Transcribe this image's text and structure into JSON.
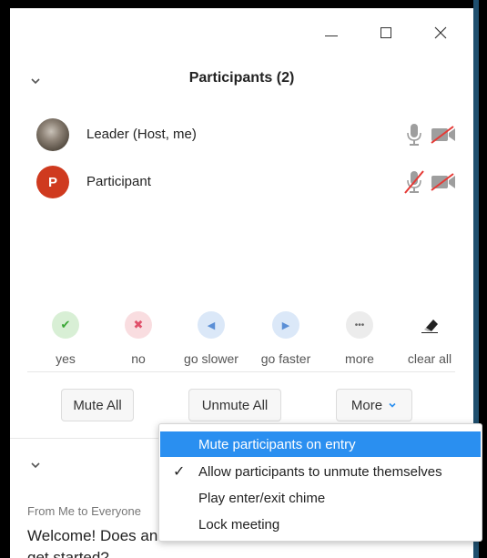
{
  "panel": {
    "title": "Participants (2)"
  },
  "participants": [
    {
      "name": "Leader (Host, me)",
      "avatar_letter": ""
    },
    {
      "name": "Participant",
      "avatar_letter": "P"
    }
  ],
  "reactions": [
    {
      "label": "yes",
      "icon": "check-icon",
      "glyph": "✔",
      "bg": "#d8efd5",
      "fg": "#3aa735"
    },
    {
      "label": "no",
      "icon": "x-icon",
      "glyph": "✖",
      "bg": "#f9dde0",
      "fg": "#e0506a"
    },
    {
      "label": "go slower",
      "icon": "rewind-icon",
      "glyph": "◀",
      "bg": "#dbe8f8",
      "fg": "#5b8fd6"
    },
    {
      "label": "go faster",
      "icon": "fast-forward-icon",
      "glyph": "▶",
      "bg": "#dbe8f8",
      "fg": "#5b8fd6"
    },
    {
      "label": "more",
      "icon": "more-icon",
      "glyph": "•••",
      "bg": "#ececec",
      "fg": "#666666"
    },
    {
      "label": "clear all",
      "icon": "eraser-icon",
      "glyph": "",
      "bg": "#ffffff",
      "fg": "#222222"
    }
  ],
  "buttons": {
    "mute_all": "Mute All",
    "unmute_all": "Unmute All",
    "more": "More"
  },
  "menu": {
    "items": [
      {
        "label": "Mute participants on entry",
        "checked": false,
        "highlighted": true
      },
      {
        "label": "Allow participants to unmute themselves",
        "checked": true,
        "highlighted": false
      },
      {
        "label": "Play enter/exit chime",
        "checked": false,
        "highlighted": false
      },
      {
        "label": "Lock meeting",
        "checked": false,
        "highlighted": false
      }
    ],
    "check_glyph": "✓"
  },
  "chat": {
    "meta": "From Me to Everyone",
    "message": "Welcome! Does an we get started?"
  },
  "colors": {
    "accent": "#2a8ff0",
    "mute_red": "#e53935",
    "avatar_red": "#cf3a1f"
  }
}
